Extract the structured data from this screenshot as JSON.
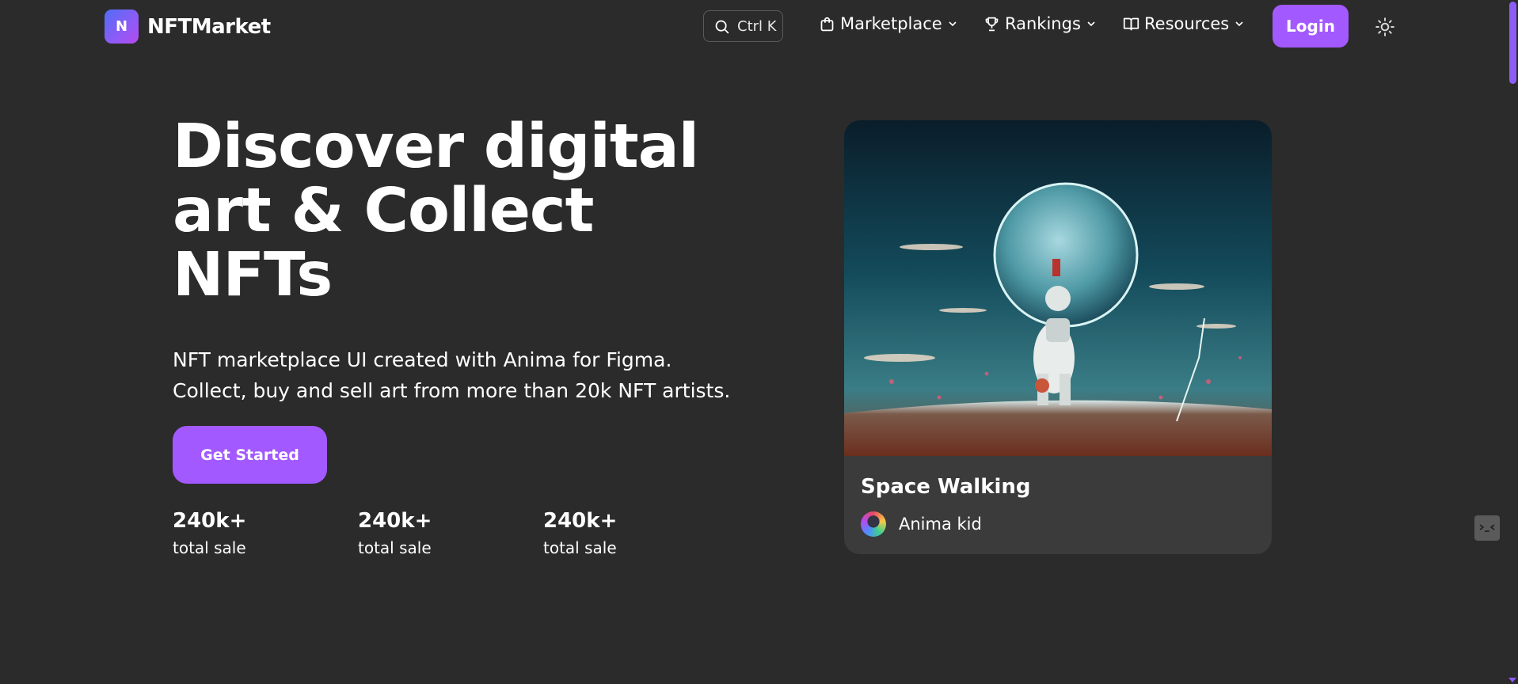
{
  "brand": {
    "logo_letter": "N",
    "name": "NFTMarket"
  },
  "header": {
    "search_shortcut": "Ctrl K",
    "nav": [
      {
        "label": "Marketplace",
        "icon": "shopping-bag-icon"
      },
      {
        "label": "Rankings",
        "icon": "trophy-icon"
      },
      {
        "label": "Resources",
        "icon": "book-icon"
      }
    ],
    "login_label": "Login",
    "theme_icon": "sun-icon"
  },
  "hero": {
    "title_line1": "Discover digital",
    "title_line2": "art & Collect",
    "title_line3": "NFTs",
    "subtitle_line1": "NFT marketplace UI created with Anima for Figma.",
    "subtitle_line2": "Collect, buy and sell art from more than 20k NFT artists.",
    "cta_label": "Get Started",
    "stats": [
      {
        "value": "240k+",
        "label": "total sale"
      },
      {
        "value": "240k+",
        "label": "total sale"
      },
      {
        "value": "240k+",
        "label": "total sale"
      }
    ]
  },
  "featured": {
    "title": "Space Walking",
    "artist": "Anima kid"
  },
  "colors": {
    "background": "#2b2b2b",
    "accent": "#a259ff",
    "card": "#3b3b3b"
  }
}
